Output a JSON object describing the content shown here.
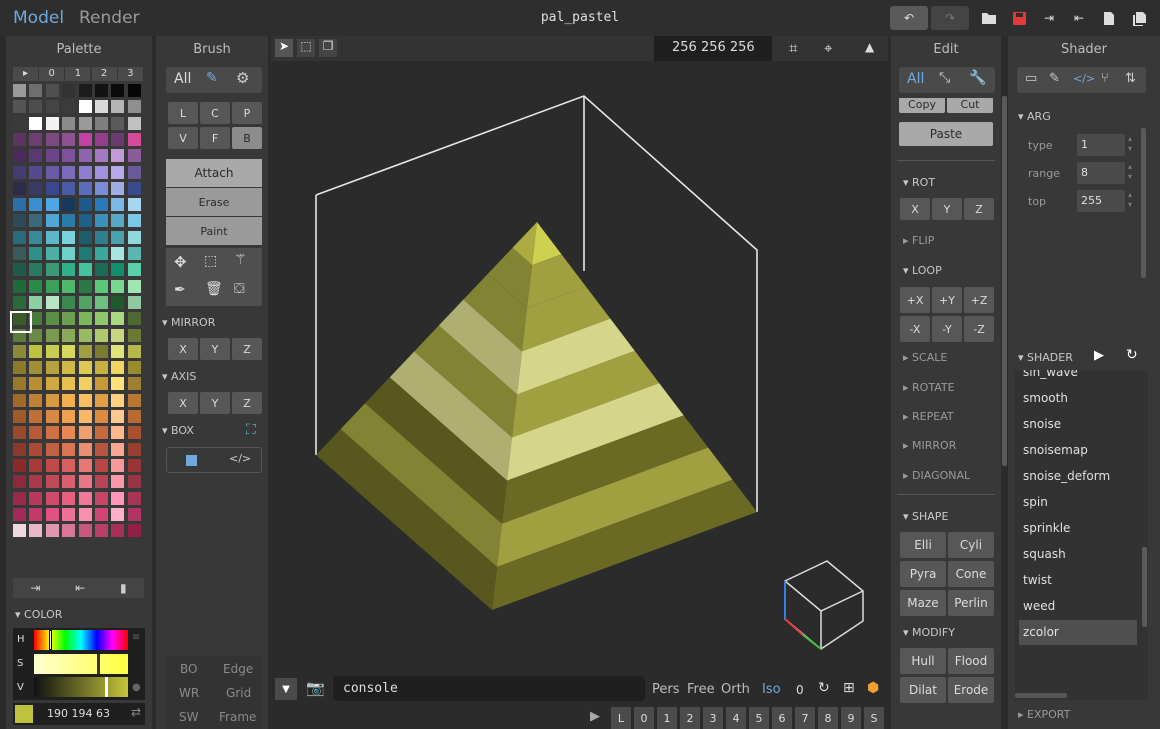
{
  "tabs": {
    "model": "Model",
    "render": "Render"
  },
  "file_title": "pal_pastel",
  "palette": {
    "title": "Palette",
    "header": [
      "▸",
      "0",
      "1",
      "2",
      "3"
    ],
    "rows": [
      [
        "#9a9a9a",
        "#6e6e6e",
        "#4f4f4f",
        "#333333",
        "#1c1c1c",
        "#121212",
        "#0b0b0b",
        "#060606"
      ],
      [
        "#555555",
        "#4d4d4d",
        "#444444",
        "#3b3b3b",
        "#ffffff",
        "#d9d9d9",
        "#b5b5b5",
        "#8f8f8f"
      ],
      [
        "#3a3a3a",
        "#ffffff",
        "#f2f2f2",
        "#8b8b8b",
        "#9a9a9a",
        "#7f7f7f",
        "#5a5a5a",
        "#c1c1c1"
      ],
      [
        "#5b3560",
        "#6d3e72",
        "#7c4a80",
        "#8c5390",
        "#c142a3",
        "#933d8b",
        "#6b3a6e",
        "#d34b9a"
      ],
      [
        "#4a2b5a",
        "#5b3a73",
        "#6d4487",
        "#7e519c",
        "#8f63b0",
        "#a37ac1",
        "#c39ad8",
        "#8b5b9b"
      ],
      [
        "#453b73",
        "#56498e",
        "#6a5aa6",
        "#7c6abd",
        "#8f7dd0",
        "#a292de",
        "#b8aae8",
        "#6a5a99"
      ],
      [
        "#2b2b4a",
        "#3a3a66",
        "#3a478f",
        "#4a5aa6",
        "#5b6dbd",
        "#7a8cd6",
        "#9eaee6",
        "#3a4a8f"
      ],
      [
        "#2c6fa8",
        "#3a8fd0",
        "#4fa6e6",
        "#173a5a",
        "#1e5a8a",
        "#2a7ab8",
        "#7ab8e6",
        "#a8d6f2"
      ],
      [
        "#2b4a5a",
        "#3a6a7a",
        "#4fa6d6",
        "#2a7aa8",
        "#1f5f8a",
        "#3d8fb8",
        "#5aa8c8",
        "#7ac8e6"
      ],
      [
        "#2a6a7a",
        "#3a8a9a",
        "#5ab8c8",
        "#7ad0dc",
        "#1d5c6b",
        "#2f7f8e",
        "#4aa0ad",
        "#8fd8e0"
      ],
      [
        "#3a5a5a",
        "#2f8f8a",
        "#4ab0a6",
        "#6fd0c8",
        "#1e7a72",
        "#3aa89a",
        "#a8e6e0",
        "#5ab8b0"
      ],
      [
        "#1f5a4a",
        "#2a7a5f",
        "#3a9a75",
        "#2fb08a",
        "#46c29e",
        "#1a6a55",
        "#0f8f6e",
        "#5ad0a6"
      ],
      [
        "#1f6a3a",
        "#2a8a4a",
        "#3aa05a",
        "#4fb86a",
        "#2a7a45",
        "#5ac878",
        "#78d891",
        "#a0e6b0"
      ],
      [
        "#2a6a3a",
        "#8fd0a0",
        "#b8e6c3",
        "#3a8a4f",
        "#52a366",
        "#6ebf82",
        "#1e5a2e",
        "#90c8a0"
      ],
      [
        "#3a5a2a",
        "#4a7a3a",
        "#5a8f45",
        "#6aa050",
        "#7ab85a",
        "#8fc86a",
        "#a8d880",
        "#4f6a30"
      ],
      [
        "#5a7a3a",
        "#6a8a45",
        "#7a9a50",
        "#8aaa5a",
        "#9aba65",
        "#b0c870",
        "#c8d880",
        "#6a7a35"
      ],
      [
        "#8a8a3a",
        "#beC23f",
        "#c8cc50",
        "#d6d860",
        "#a0a040",
        "#7a7a30",
        "#e0e27a",
        "#b8b84a"
      ],
      [
        "#8a7a2a",
        "#a08f35",
        "#b8a040",
        "#d0b84a",
        "#e0c855",
        "#c8b040",
        "#f0d860",
        "#9a8a30"
      ],
      [
        "#9a7a2a",
        "#b88f35",
        "#d0a840",
        "#e8c050",
        "#f0d060",
        "#c89a35",
        "#ffe27a",
        "#a08030"
      ],
      [
        "#a06a2a",
        "#c08035",
        "#d89a40",
        "#f0b050",
        "#f8c060",
        "#e0a045",
        "#ffd080",
        "#b87830"
      ],
      [
        "#a05a2a",
        "#c07035",
        "#d88a45",
        "#f0a050",
        "#f8b868",
        "#e08a40",
        "#ffc890",
        "#b86a30"
      ],
      [
        "#9a4a2a",
        "#b85a35",
        "#d07045",
        "#e88855",
        "#f0a070",
        "#c86a40",
        "#ffb88a",
        "#a85030"
      ],
      [
        "#8a3a2a",
        "#a84a35",
        "#c06045",
        "#d87555",
        "#e89070",
        "#b85540",
        "#f8a890",
        "#984030"
      ],
      [
        "#8a2a2a",
        "#a83a3a",
        "#c04a4a",
        "#d86060",
        "#e87878",
        "#b84545",
        "#f89898",
        "#983535"
      ],
      [
        "#8a2a3a",
        "#a83a4a",
        "#c04a5a",
        "#d86070",
        "#e87888",
        "#b84555",
        "#f898a8",
        "#983545"
      ],
      [
        "#9a2a4a",
        "#b83a5a",
        "#d04a6a",
        "#e86080",
        "#f07898",
        "#c84565",
        "#ff98b8",
        "#a83555"
      ],
      [
        "#a02a5a",
        "#c03a6a",
        "#e05080",
        "#f07098",
        "#f890b0",
        "#d04575",
        "#ffb0c8",
        "#b03565"
      ],
      [
        "#f0d8e0",
        "#e8b8c8",
        "#e098b0",
        "#d87898",
        "#c85880",
        "#b84068",
        "#a83058",
        "#902048"
      ]
    ],
    "selected_color": "#bec23f",
    "footer_icons": [
      "import-icon",
      "export-icon",
      "new-file-icon"
    ]
  },
  "color": {
    "section": "COLOR",
    "h_label": "H",
    "s_label": "S",
    "v_label": "V",
    "rgb": "190 194 63"
  },
  "brush": {
    "title": "Brush",
    "all_label": "All",
    "grid": [
      "L",
      "C",
      "P",
      "V",
      "F",
      "B"
    ],
    "modes": [
      "Attach",
      "Erase",
      "Paint"
    ],
    "mirror_section": "MIRROR",
    "axis_section": "AXIS",
    "box_section": "BOX",
    "xyz": [
      "X",
      "Y",
      "Z"
    ],
    "bottom": {
      "bo": "BO",
      "edge": "Edge",
      "wr": "WR",
      "grid": "Grid",
      "sw": "SW",
      "frame": "Frame"
    }
  },
  "viewport": {
    "size": "256 256 256",
    "console_placeholder": "console",
    "views": [
      "Pers",
      "Free",
      "Orth",
      "Iso"
    ],
    "count": "0",
    "slots": [
      "L",
      "0",
      "1",
      "2",
      "3",
      "4",
      "5",
      "6",
      "7",
      "8",
      "9",
      "S"
    ],
    "colors": {
      "light": "#d6d68a",
      "mid": "#a0a040",
      "dark": "#6a6a25",
      "tip": "#d0d050"
    }
  },
  "edit": {
    "title": "Edit",
    "all_label": "All",
    "copy": "Copy",
    "cut": "Cut",
    "paste": "Paste",
    "rot": "ROT",
    "xyz": [
      "X",
      "Y",
      "Z"
    ],
    "flip": "FLIP",
    "loop": "LOOP",
    "loop_btns": [
      "+X",
      "+Y",
      "+Z",
      "-X",
      "-Y",
      "-Z"
    ],
    "scale": "SCALE",
    "rotate": "ROTATE",
    "repeat": "REPEAT",
    "mirror": "MIRROR",
    "diagonal": "DIAGONAL",
    "shape": "SHAPE",
    "shape_btns": [
      "Elli",
      "Cyli",
      "Pyra",
      "Cone",
      "Maze",
      "Perlin"
    ],
    "modify": "MODIFY",
    "modify_btns": [
      "Hull",
      "Flood",
      "Dilat",
      "Erode"
    ]
  },
  "shader": {
    "title": "Shader",
    "arg_section": "ARG",
    "args": [
      {
        "label": "type",
        "value": "1"
      },
      {
        "label": "range",
        "value": "8"
      },
      {
        "label": "top",
        "value": "255"
      }
    ],
    "shader_section": "SHADER",
    "list": [
      "sin_wave",
      "smooth",
      "snoise",
      "snoisemap",
      "snoise_deform",
      "spin",
      "sprinkle",
      "squash",
      "twist",
      "weed",
      "zcolor"
    ],
    "selected": "zcolor",
    "export": "EXPORT"
  }
}
